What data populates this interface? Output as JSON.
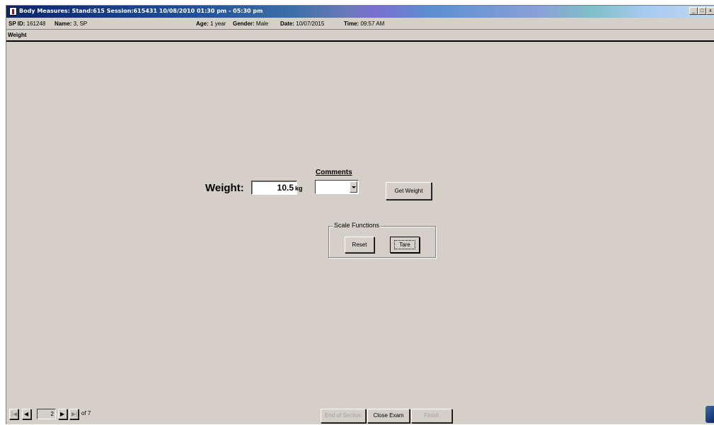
{
  "window": {
    "title": "Body Measures: Stand:615 Session:615431 10/08/2010 01:30 pm - 05:30 pm",
    "controls": {
      "minimize": "_",
      "maximize": "□",
      "close": "x"
    }
  },
  "info": {
    "sp_id_label": "SP ID:",
    "sp_id": "161248",
    "name_label": "Name:",
    "name": "3, SP",
    "age_label": "Age:",
    "age": "1 year",
    "gender_label": "Gender:",
    "gender": "Male",
    "date_label": "Date:",
    "date": "10/07/2015",
    "time_label": "Time:",
    "time": "09:57 AM"
  },
  "section": {
    "title": "Weight"
  },
  "form": {
    "weight_label": "Weight:",
    "weight_value": "10.5",
    "weight_unit": "kg",
    "comments_label": "Comments",
    "comments_value": "",
    "get_weight_label": "Get Weight"
  },
  "scale_functions": {
    "title": "Scale Functions",
    "reset_label": "Reset",
    "tare_label": "Tare"
  },
  "navigation": {
    "current_page": "2",
    "of_label": "of 7",
    "end_of_section_label": "End of Section",
    "close_exam_label": "Close Exam",
    "finish_label": "Finish"
  }
}
